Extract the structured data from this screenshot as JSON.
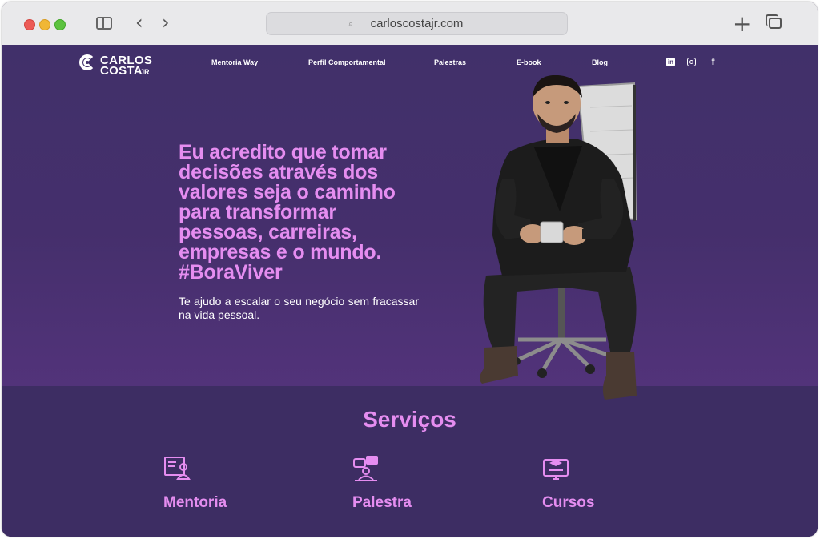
{
  "browser": {
    "url": "carloscostajr.com"
  },
  "site": {
    "logo": {
      "line1": "CARLOS",
      "line2": "COSTA",
      "suffix": "JR"
    },
    "nav": [
      {
        "label": "Mentoria Way"
      },
      {
        "label": "Perfil Comportamental"
      },
      {
        "label": "Palestras"
      },
      {
        "label": "E-book"
      },
      {
        "label": "Blog"
      }
    ],
    "social": [
      {
        "icon": "linkedin-icon",
        "glyph": "in"
      },
      {
        "icon": "instagram-icon"
      },
      {
        "icon": "facebook-icon",
        "glyph": "f"
      }
    ]
  },
  "hero": {
    "headline_lines": [
      "Eu acredito que tomar",
      "decisões através dos",
      "valores seja o caminho",
      "para transformar",
      "pessoas, carreiras,",
      "empresas e o mundo.",
      "#BoraViver"
    ],
    "subline": "Te ajudo a escalar o seu negócio sem fracassar na vida pessoal."
  },
  "services": {
    "title": "Serviços",
    "items": [
      {
        "label": "Mentoria",
        "icon": "mentoring-icon"
      },
      {
        "label": "Palestra",
        "icon": "speaker-icon"
      },
      {
        "label": "Cursos",
        "icon": "online-course-icon"
      }
    ]
  },
  "colors": {
    "accent": "#e58df0",
    "background": "#3e2c63"
  }
}
